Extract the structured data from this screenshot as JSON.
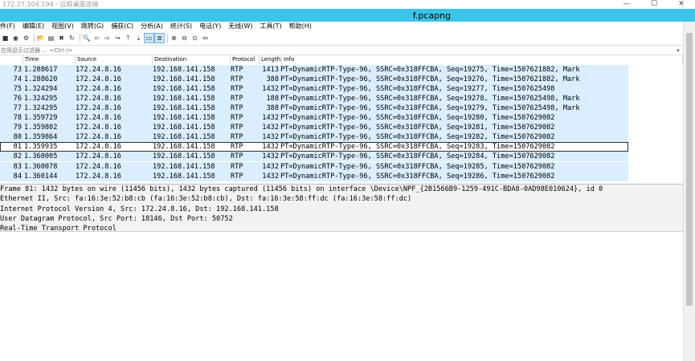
{
  "remote_window": {
    "title": "172.27.104.194 - 远程桌面连接",
    "minimize_glyph": "—",
    "maximize_glyph": "☐",
    "close_glyph": "✕"
  },
  "app": {
    "title": "f.pcapng"
  },
  "menu": [
    "件(F)",
    "编辑(E)",
    "视图(V)",
    "跳转(G)",
    "捕获(C)",
    "分析(A)",
    "统计(S)",
    "电话(Y)",
    "无线(W)",
    "工具(T)",
    "帮助(H)"
  ],
  "toolbar": {
    "icons": [
      "stop-capture-icon",
      "restart-capture-icon",
      "capture-options-icon",
      "open-file-icon",
      "save-file-icon",
      "close-file-icon",
      "reload-file-icon",
      "find-packet-icon",
      "go-back-icon",
      "go-forward-icon",
      "go-to-packet-icon",
      "first-packet-icon",
      "last-packet-icon",
      "auto-scroll-icon",
      "colorize-icon",
      "zoom-in-icon",
      "zoom-out-icon",
      "normal-size-icon",
      "resize-columns-icon"
    ],
    "glyphs": [
      "■",
      "◉",
      "⚙",
      "📂",
      "▤",
      "✖",
      "↻",
      "🔍",
      "⇦",
      "⇨",
      "↪",
      "⤒",
      "⤓",
      "▭",
      "≣",
      "⊕",
      "⊖",
      "⊙",
      "⇔"
    ]
  },
  "filter": {
    "placeholder": "应用显示过滤器 … <Ctrl-/>"
  },
  "columns": {
    "no": "",
    "time": "Time",
    "source": "Source",
    "destination": "Destination",
    "protocol": "Protocol",
    "length": "Length",
    "info": "Info"
  },
  "packets": [
    {
      "no": "73",
      "time": "1.288617",
      "src": "172.24.8.16",
      "dst": "192.168.141.158",
      "proto": "RTP",
      "len": "1413",
      "info": "PT=DynamicRTP-Type-96, SSRC=0x318FFCBA, Seq=19275, Time=1507621882, Mark"
    },
    {
      "no": "74",
      "time": "1.288620",
      "src": "172.24.8.16",
      "dst": "192.168.141.158",
      "proto": "RTP",
      "len": "388",
      "info": "PT=DynamicRTP-Type-96, SSRC=0x318FFCBA, Seq=19276, Time=1507621882, Mark"
    },
    {
      "no": "75",
      "time": "1.324294",
      "src": "172.24.8.16",
      "dst": "192.168.141.158",
      "proto": "RTP",
      "len": "1432",
      "info": "PT=DynamicRTP-Type-96, SSRC=0x318FFCBA, Seq=19277, Time=1507625498"
    },
    {
      "no": "76",
      "time": "1.324295",
      "src": "172.24.8.16",
      "dst": "192.168.141.158",
      "proto": "RTP",
      "len": "188",
      "info": "PT=DynamicRTP-Type-96, SSRC=0x318FFCBA, Seq=19278, Time=1507625498, Mark"
    },
    {
      "no": "77",
      "time": "1.324295",
      "src": "172.24.8.16",
      "dst": "192.168.141.158",
      "proto": "RTP",
      "len": "388",
      "info": "PT=DynamicRTP-Type-96, SSRC=0x318FFCBA, Seq=19279, Time=1507625498, Mark"
    },
    {
      "no": "78",
      "time": "1.359729",
      "src": "172.24.8.16",
      "dst": "192.168.141.158",
      "proto": "RTP",
      "len": "1432",
      "info": "PT=DynamicRTP-Type-96, SSRC=0x318FFCBA, Seq=19280, Time=1507629082"
    },
    {
      "no": "79",
      "time": "1.359802",
      "src": "172.24.8.16",
      "dst": "192.168.141.158",
      "proto": "RTP",
      "len": "1432",
      "info": "PT=DynamicRTP-Type-96, SSRC=0x318FFCBA, Seq=19281, Time=1507629082"
    },
    {
      "no": "80",
      "time": "1.359864",
      "src": "172.24.8.16",
      "dst": "192.168.141.158",
      "proto": "RTP",
      "len": "1432",
      "info": "PT=DynamicRTP-Type-96, SSRC=0x318FFCBA, Seq=19282, Time=1507629082"
    },
    {
      "no": "81",
      "time": "1.359935",
      "src": "172.24.8.16",
      "dst": "192.168.141.158",
      "proto": "RTP",
      "len": "1432",
      "info": "PT=DynamicRTP-Type-96, SSRC=0x318FFCBA, Seq=19283, Time=1507629082",
      "selected": true
    },
    {
      "no": "82",
      "time": "1.360005",
      "src": "172.24.8.16",
      "dst": "192.168.141.158",
      "proto": "RTP",
      "len": "1432",
      "info": "PT=DynamicRTP-Type-96, SSRC=0x318FFCBA, Seq=19284, Time=1507629082"
    },
    {
      "no": "83",
      "time": "1.360078",
      "src": "172.24.8.16",
      "dst": "192.168.141.158",
      "proto": "RTP",
      "len": "1432",
      "info": "PT=DynamicRTP-Type-96, SSRC=0x318FFCBA, Seq=19285, Time=1507629082"
    },
    {
      "no": "84",
      "time": "1.360144",
      "src": "172.24.8.16",
      "dst": "192.168.141.158",
      "proto": "RTP",
      "len": "1432",
      "info": "PT=DynamicRTP-Type-96, SSRC=0x318FFCBA, Seq=19286, Time=1507629082"
    }
  ],
  "details": [
    "Frame 81: 1432 bytes on wire (11456 bits), 1432 bytes captured (11456 bits) on interface \\Device\\NPF_{2B1566B9-1259-491C-BDA8-0AD98E010624}, id 0",
    "Ethernet II, Src: fa:16:3e:52:b8:cb (fa:16:3e:52:b8:cb), Dst: fa:16:3e:58:ff:dc (fa:16:3e:58:ff:dc)",
    "Internet Protocol Version 4, Src: 172.24.8.16, Dst: 192.168.141.158",
    "User Datagram Protocol, Src Port: 18146, Dst Port: 50752",
    "Real-Time Transport Protocol"
  ],
  "colors": {
    "titlebar": "#3cc4ea",
    "row_bg": "#daeeff",
    "details_bg": "#f2f2f2"
  }
}
